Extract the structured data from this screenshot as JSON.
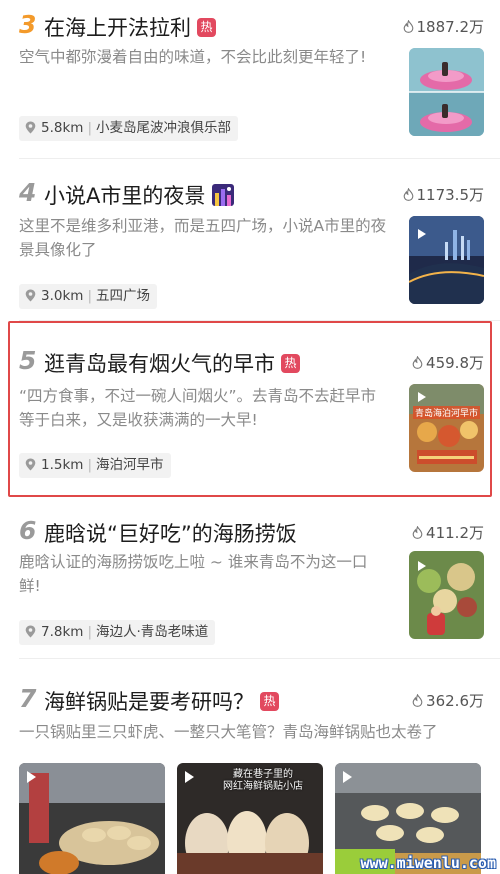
{
  "items": [
    {
      "rank": "3",
      "rank_color": "#f39a2b",
      "title": "在海上开法拉利",
      "hot": true,
      "hot_label": "热",
      "heat": "1887.2万",
      "desc": "空气中都弥漫着自由的味道，不会比此刻更年轻了!",
      "distance": "5.8km",
      "place": "小麦岛尾波冲浪俱乐部"
    },
    {
      "rank": "4",
      "rank_color": "#9a9a9a",
      "title": "小说A市里的夜景",
      "hot": false,
      "heat": "1173.5万",
      "desc": "这里不是维多利亚港，而是五四广场，小说A市里的夜景具像化了",
      "distance": "3.0km",
      "place": "五四广场"
    },
    {
      "rank": "5",
      "rank_color": "#9a9a9a",
      "title": "逛青岛最有烟火气的早市",
      "hot": true,
      "hot_label": "热",
      "heat": "459.8万",
      "desc": "“四方食事，不过一碗人间烟火”。去青岛不去赶早市等于白来，又是收获满满的一大早!",
      "distance": "1.5km",
      "place": "海泊河早市",
      "thumb_caption": "青岛海泊河早市"
    },
    {
      "rank": "6",
      "rank_color": "#9a9a9a",
      "title": "鹿晗说“巨好吃”的海肠捞饭",
      "hot": false,
      "heat": "411.2万",
      "desc": "鹿晗认证的海肠捞饭吃上啦 ~ 谁来青岛不为这一口鲜!",
      "distance": "7.8km",
      "place": "海边人·青岛老味道"
    },
    {
      "rank": "7",
      "rank_color": "#9a9a9a",
      "title": "海鲜锅贴是要考研吗？",
      "hot": true,
      "hot_label": "热",
      "heat": "362.6万",
      "desc": "一只锅贴里三只虾虎、一整只大笔管？青岛海鲜锅贴也太卷了",
      "gallery_caption_line1": "藏在巷子里的",
      "gallery_caption_line2": "网红海鲜锅贴小店"
    }
  ],
  "watermark": "www.miwenlu.com",
  "colors": {
    "hot_badge": "#e2495f",
    "highlight_border": "#e04848"
  },
  "icons": {
    "heat": "flame-icon",
    "location": "location-pin-icon",
    "play": "play-icon"
  }
}
